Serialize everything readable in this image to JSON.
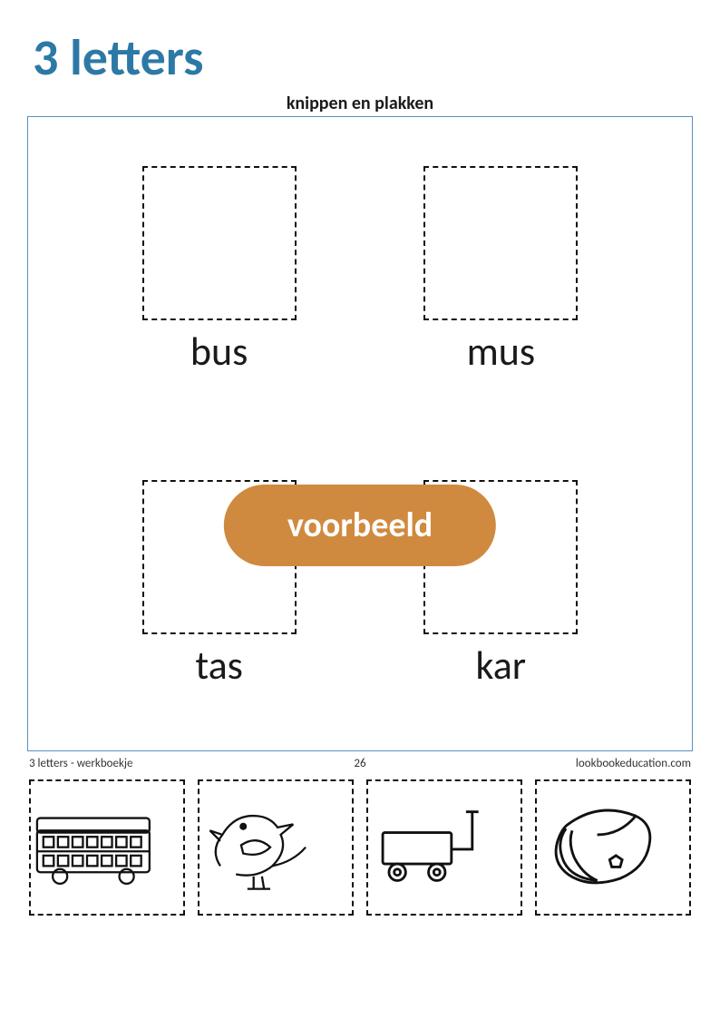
{
  "title": "3 letters",
  "subtitle": "knippen en plakken",
  "words": {
    "top_left": "bus",
    "top_right": "mus",
    "bottom_left": "tas",
    "bottom_right": "kar"
  },
  "badge": "voorbeeld",
  "footer": {
    "left": "3 letters - werkboekje",
    "page": "26",
    "right": "lookbookeducation.com"
  },
  "cutouts": [
    "bus-icon",
    "bird-icon",
    "cart-icon",
    "bag-icon"
  ],
  "colors": {
    "title": "#2d79a6",
    "badge": "#d08a3f",
    "border": "#5a8fbf"
  }
}
